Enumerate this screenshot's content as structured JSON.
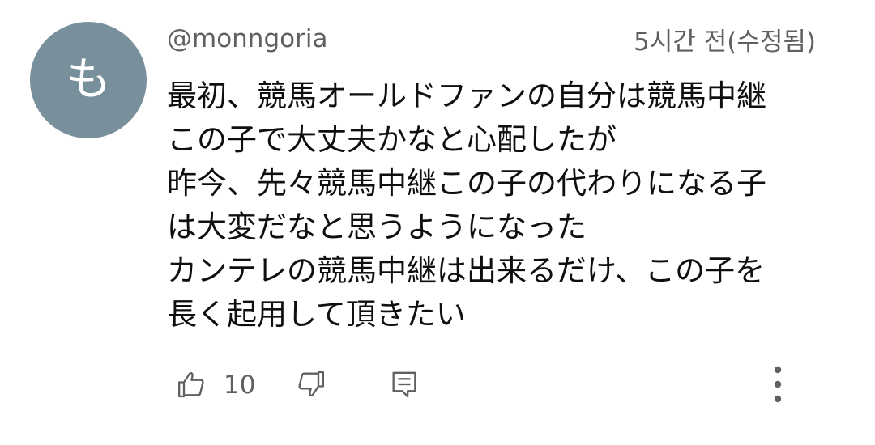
{
  "comment": {
    "avatar_initial": "も",
    "avatar_color": "#78909c",
    "author": "@monngoria",
    "timestamp": "5시간 전(수정됨)",
    "body_lines": [
      "最初、競馬オールドファンの自分は競馬中継",
      "この子で大丈夫かなと心配したが",
      "昨今、先々競馬中継この子の代わりになる子",
      "は大変だなと思うようになった",
      "カンテレの競馬中継は出来るだけ、この子を",
      "長く起用して頂きたい"
    ],
    "like_count": "10",
    "icons": {
      "like": "thumbs-up-icon",
      "dislike": "thumbs-down-icon",
      "reply": "reply-icon",
      "more": "more-vertical-icon"
    }
  }
}
